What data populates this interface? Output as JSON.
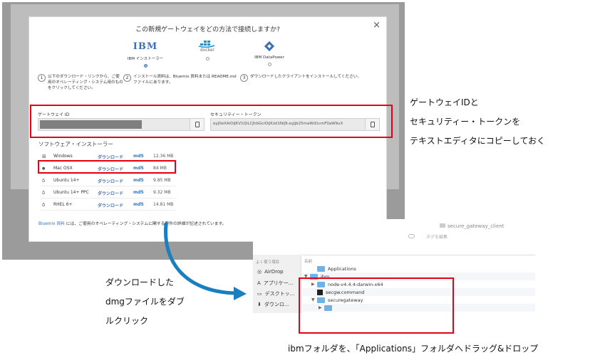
{
  "modal": {
    "title": "この新規ゲートウェイをどの方法で接続しますか?",
    "close_glyph": "×",
    "options": [
      {
        "logo_text": "IBM",
        "label": "IBM インストーラー",
        "selected": true
      },
      {
        "logo_text": "docker",
        "label": "",
        "selected": false
      },
      {
        "logo_text": "",
        "label": "IBM DataPower",
        "selected": false
      }
    ],
    "steps": [
      {
        "num": "1",
        "text": "以下のダウンロード・リンクから、ご使用のオペレーティング・システム用のものをクリックしてください。"
      },
      {
        "num": "2",
        "text": "インストール資料は、Bluemix 資料または README.md ファイルにあります。"
      },
      {
        "num": "3",
        "text": "ダウンロードしたクライアントをインストールしてください。"
      }
    ],
    "gateway_id_label": "ゲートウェイ ID",
    "gateway_id_value": "",
    "security_token_label": "セキュリティー・トークン",
    "security_token_value": "eyJ0eXAiOiJKV1QiLCJhbGciOiJIUzI1NiJ9.eyJjb25maWd1cmF0aW9uX",
    "installers_title": "ソフトウェア・インストーラー",
    "installers": [
      {
        "os_icon": "windows-icon",
        "glyph": "⊞",
        "name": "Windows",
        "download": "ダウンロード",
        "md5": "md5",
        "size": "12.36 MB"
      },
      {
        "os_icon": "apple-icon",
        "glyph": "●",
        "name": "Mac OSX",
        "download": "ダウンロード",
        "md5": "md5",
        "size": "84 MB"
      },
      {
        "os_icon": "linux-icon",
        "glyph": "δ",
        "name": "Ubuntu 14+",
        "download": "ダウンロード",
        "md5": "md5",
        "size": "9.85 MB"
      },
      {
        "os_icon": "linux-icon",
        "glyph": "δ",
        "name": "Ubuntu 14+ PPC",
        "download": "ダウンロード",
        "md5": "md5",
        "size": "9.32 MB"
      },
      {
        "os_icon": "linux-icon",
        "glyph": "δ",
        "name": "RHEL 6+",
        "download": "ダウンロード",
        "md5": "md5",
        "size": "14.81 MB"
      }
    ],
    "footer_link": "Bluemix 資料",
    "footer_text": " には、ご使用のオペレーティング・システムに関する要件の詳細が記述されています。"
  },
  "annotations": {
    "copy_line1": "ゲートウェイIDと",
    "copy_line2": "セキュリティー・トークンを",
    "copy_line3": "テキストエディタにコピーしておく",
    "dmg_line1": "ダウンロードした",
    "dmg_line2": "dmgファイルをダブ",
    "dmg_line3": "ルクリック",
    "drag_text": "ibmフォルダを、「Applications」フォルダへドラッグ&ドロップ"
  },
  "finder": {
    "window_title": "secure_gateway_client",
    "toolbar_label": "タグを編集",
    "sidebar_header": "よく使う項目",
    "sidebar_items": [
      {
        "icon": "airdrop-icon",
        "glyph": "◎",
        "label": "AirDrop"
      },
      {
        "icon": "applications-icon",
        "glyph": "A",
        "label": "アプリケー..."
      },
      {
        "icon": "desktop-icon",
        "glyph": "▭",
        "label": "デスクトッ..."
      },
      {
        "icon": "downloads-icon",
        "glyph": "⬇",
        "label": "ダウンロ..."
      }
    ],
    "list_header": "名前",
    "items": [
      {
        "indent": 0,
        "tri": "",
        "kind": "folder",
        "name": "Applications"
      },
      {
        "indent": 0,
        "tri": "▼",
        "kind": "folder",
        "name": "ibm"
      },
      {
        "indent": 1,
        "tri": "▶",
        "kind": "folder",
        "name": "node-v4.4.4-darwin-x64"
      },
      {
        "indent": 1,
        "tri": "",
        "kind": "exec",
        "name": "secgw.command"
      },
      {
        "indent": 1,
        "tri": "▼",
        "kind": "folder",
        "name": "securegateway"
      },
      {
        "indent": 2,
        "tri": "▶",
        "kind": "folder",
        "name": ""
      }
    ]
  },
  "colors": {
    "highlight": "#e60012",
    "arrow": "#1a7fbf",
    "link": "#3d70b2"
  }
}
